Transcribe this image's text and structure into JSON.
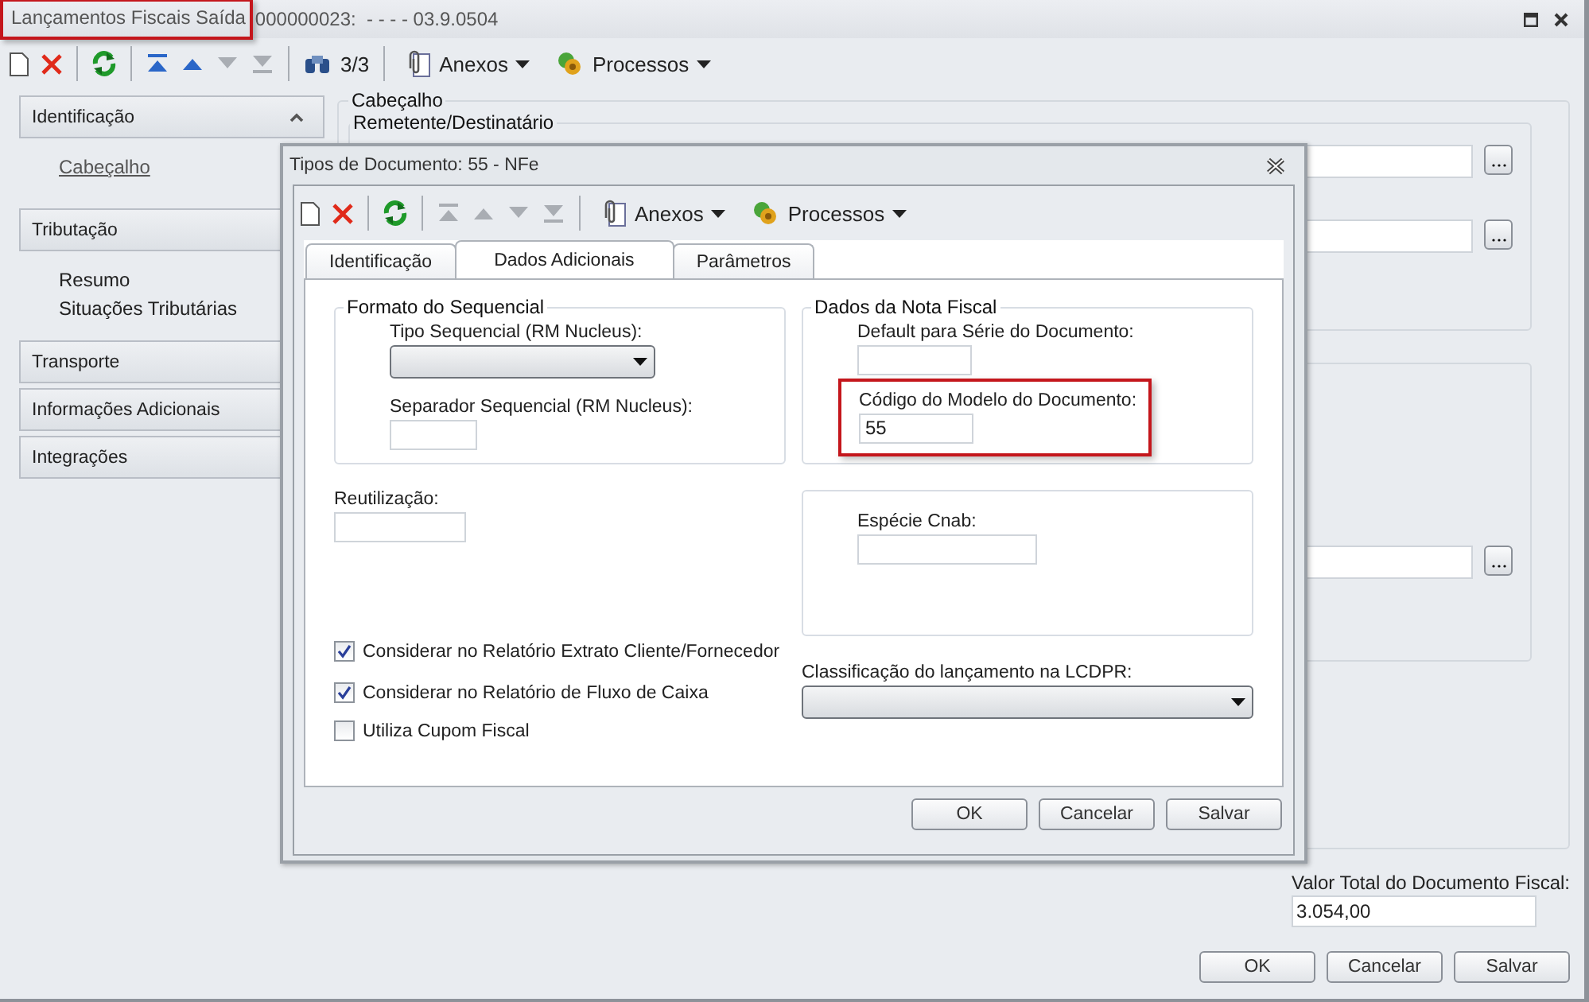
{
  "window": {
    "title": "Lançamentos Fiscais Saída",
    "record": "000000023:  - - - - 03.9.0504"
  },
  "toolbar": {
    "nav": [
      {
        "kind": "first",
        "disabled": false
      },
      {
        "kind": "previous",
        "disabled": false
      },
      {
        "kind": "next",
        "disabled": true
      },
      {
        "kind": "last",
        "disabled": true
      }
    ],
    "record_count": "3/3",
    "menus": [
      {
        "kind": "attachments",
        "label": "Anexos"
      },
      {
        "kind": "processes",
        "label": "Processos"
      }
    ]
  },
  "sidebar": {
    "sections": [
      {
        "label": "Identificação",
        "expanded": true,
        "items": [
          {
            "label": "Cabeçalho",
            "selected": true
          }
        ]
      },
      {
        "label": "Tributação",
        "items": [
          {
            "label": "Resumo",
            "selected": false
          },
          {
            "label": "Situações Tributárias",
            "selected": false
          }
        ]
      },
      {
        "label": "Transporte"
      },
      {
        "label": "Informações Adicionais"
      },
      {
        "label": "Integrações"
      }
    ]
  },
  "main": {
    "section_title": "Cabeçalho",
    "group_title": "Remetente/Destinatário",
    "total_label": "Valor Total do Documento Fiscal:",
    "total_value": "3.054,00"
  },
  "buttons": [
    "OK",
    "Cancelar",
    "Salvar"
  ],
  "dialog": {
    "title": "Tipos de Documento: 55 - NFe",
    "toolbar": {
      "nav": [
        {
          "kind": "first",
          "disabled": true
        },
        {
          "kind": "previous",
          "disabled": true
        },
        {
          "kind": "next",
          "disabled": true
        },
        {
          "kind": "last",
          "disabled": true
        }
      ],
      "menus": [
        {
          "kind": "attachments",
          "label": "Anexos"
        },
        {
          "kind": "processes",
          "label": "Processos"
        }
      ]
    },
    "tabs": [
      {
        "label": "Identificação",
        "selected": false
      },
      {
        "label": "Dados Adicionais",
        "selected": true
      },
      {
        "label": "Parâmetros",
        "selected": false
      }
    ],
    "sequence_group": {
      "title": "Formato do Sequencial",
      "type_label": "Tipo Sequencial (RM Nucleus):",
      "separator_label": "Separador Sequencial (RM Nucleus):"
    },
    "invoice_group": {
      "title": "Dados da Nota Fiscal",
      "series_label": "Default para Série do Documento:",
      "model_label": "Código do Modelo do Documento:",
      "model_value": "55"
    },
    "reuse_label": "Reutilização:",
    "cnab_label": "Espécie Cnab:",
    "checkboxes": [
      {
        "label": "Considerar no Relatório Extrato Cliente/Fornecedor",
        "checked": true
      },
      {
        "label": "Considerar no Relatório de Fluxo de Caixa",
        "checked": true
      },
      {
        "label": "Utiliza Cupom Fiscal",
        "checked": false
      }
    ],
    "classification_label": "Classificação do lançamento na LCDPR:",
    "buttons": [
      "OK",
      "Cancelar",
      "Salvar"
    ]
  }
}
